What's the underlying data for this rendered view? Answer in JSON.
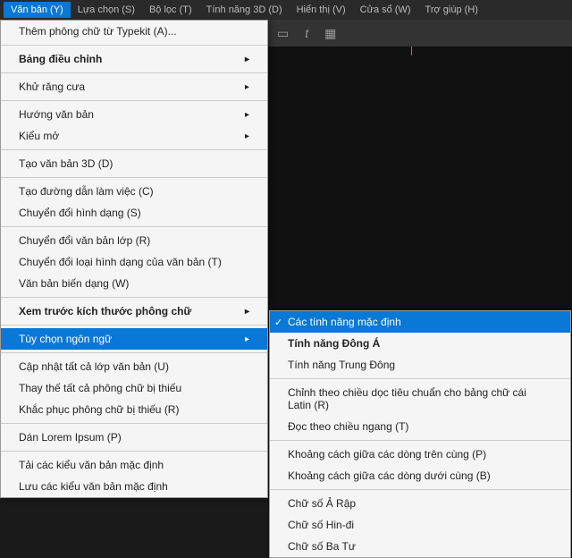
{
  "menubar": [
    {
      "label": "Văn bản (Y)",
      "active": true
    },
    {
      "label": "Lựa chọn (S)"
    },
    {
      "label": "Bộ lọc (T)"
    },
    {
      "label": "Tính năng 3D (D)"
    },
    {
      "label": "Hiển thị (V)"
    },
    {
      "label": "Cửa sổ (W)"
    },
    {
      "label": "Trợ giúp (H)"
    }
  ],
  "dropdown": [
    {
      "label": "Thêm phông chữ từ Typekit (A)..."
    },
    {
      "sep": true
    },
    {
      "label": "Bảng điều chỉnh",
      "bold": true,
      "arrow": true
    },
    {
      "sep": true
    },
    {
      "label": "Khử răng cưa",
      "arrow": true
    },
    {
      "sep": true
    },
    {
      "label": "Hướng văn bản",
      "arrow": true
    },
    {
      "label": "Kiểu mở",
      "arrow": true
    },
    {
      "sep": true
    },
    {
      "label": "Tạo văn bản 3D (D)"
    },
    {
      "sep": true
    },
    {
      "label": "Tạo đường dẫn làm việc (C)"
    },
    {
      "label": "Chuyển đổi hình dạng (S)"
    },
    {
      "sep": true
    },
    {
      "label": "Chuyển đổi văn bản lớp (R)"
    },
    {
      "label": "Chuyển đổi loại hình dạng của văn bản (T)"
    },
    {
      "label": "Văn bản biến dạng (W)"
    },
    {
      "sep": true
    },
    {
      "label": "Xem trước kích thước phông chữ",
      "bold": true,
      "arrow": true
    },
    {
      "sep": true
    },
    {
      "label": "Tùy chọn ngôn ngữ",
      "hover": true,
      "arrow": true
    },
    {
      "sep": true
    },
    {
      "label": "Cập nhật tất cả lớp văn bản (U)"
    },
    {
      "label": "Thay thế tất cả phông chữ bị thiếu"
    },
    {
      "label": "Khắc phục phông chữ bị thiếu (R)"
    },
    {
      "sep": true
    },
    {
      "label": "Dán Lorem Ipsum (P)"
    },
    {
      "sep": true
    },
    {
      "label": "Tải các kiểu văn bản mặc định"
    },
    {
      "label": "Lưu các kiểu văn bản mặc định"
    }
  ],
  "submenu": [
    {
      "label": "Các tính năng mặc định",
      "hover": true,
      "check": true
    },
    {
      "label": "Tính năng Đông Á",
      "bold": true
    },
    {
      "label": "Tính năng Trung Đông"
    },
    {
      "sep": true
    },
    {
      "label": "Chỉnh theo chiều dọc tiêu chuẩn cho bảng chữ cái Latin (R)"
    },
    {
      "label": "Đọc theo chiều ngang (T)"
    },
    {
      "sep": true
    },
    {
      "label": "Khoảng cách giữa các dòng trên cùng (P)"
    },
    {
      "label": "Khoảng cách giữa các dòng dưới cùng (B)"
    },
    {
      "sep": true
    },
    {
      "label": "Chữ số Ả Rập"
    },
    {
      "label": "Chữ số Hin-đi"
    },
    {
      "label": "Chữ số Ba Tư"
    }
  ]
}
